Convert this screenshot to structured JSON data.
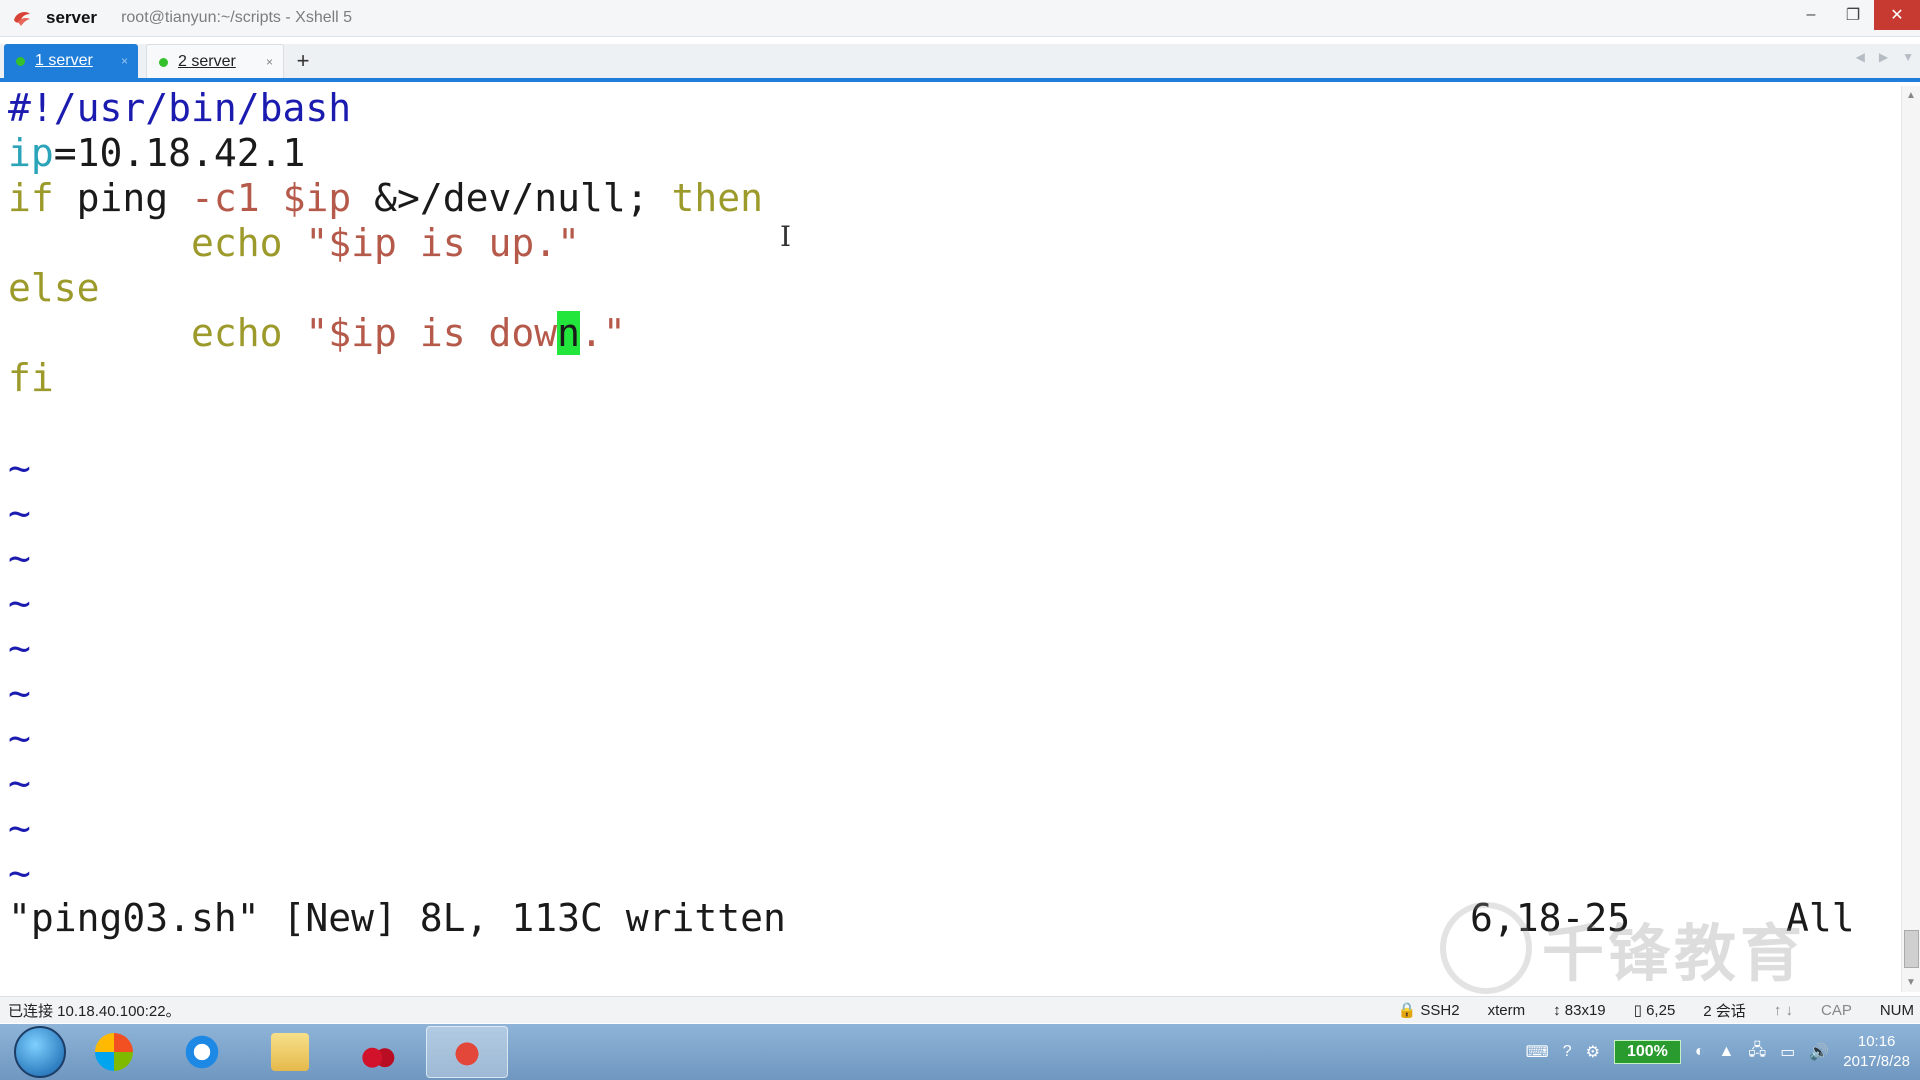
{
  "window": {
    "title_main": "server",
    "title_sub": "root@tianyun:~/scripts - Xshell 5",
    "minimize_label": "–",
    "restore_label": "❐",
    "close_label": "✕"
  },
  "tabs": [
    {
      "label": "1 server",
      "close": "×"
    },
    {
      "label": "2 server",
      "close": "×"
    }
  ],
  "tab_add_label": "+",
  "editor": {
    "lines": {
      "l1": {
        "text": "#!/usr/bin/bash"
      },
      "l2": {
        "a": "ip",
        "b": "=10.18.42.1"
      },
      "l3": {
        "kw1": "if",
        "p1": " ping ",
        "opt": "-c1",
        "p2": " ",
        "var": "$ip",
        "p3": " &>/dev/null; ",
        "kw2": "then"
      },
      "l4": {
        "indent": "        ",
        "cmd": "echo",
        "str": " \"$ip is up.\""
      },
      "l5": {
        "kw": "else"
      },
      "l6": {
        "indent": "        ",
        "cmd": "echo",
        "str1": " \"$ip is dow",
        "cursor": "n",
        "str2": ".\""
      },
      "l7": {
        "kw": "fi"
      }
    },
    "tilde": "~",
    "status_message": "\"ping03.sh\" [New] 8L, 113C written",
    "cursor_position": "6,18-25",
    "scroll_position": "All"
  },
  "watermark": {
    "text": "千锋教育"
  },
  "statusbar": {
    "connection": "已连接 10.18.40.100:22。",
    "protocol": "SSH2",
    "terminal_type": "xterm",
    "size": "83x19",
    "cursor": "6,25",
    "sessions": "2 会话",
    "cap": "CAP",
    "num": "NUM"
  },
  "taskbar": {
    "battery": "100%",
    "time": "10:16",
    "date": "2017/8/28"
  },
  "colors": {
    "accent": "#1f7ed9",
    "cursor": "#22e63b",
    "close": "#c73a31"
  }
}
